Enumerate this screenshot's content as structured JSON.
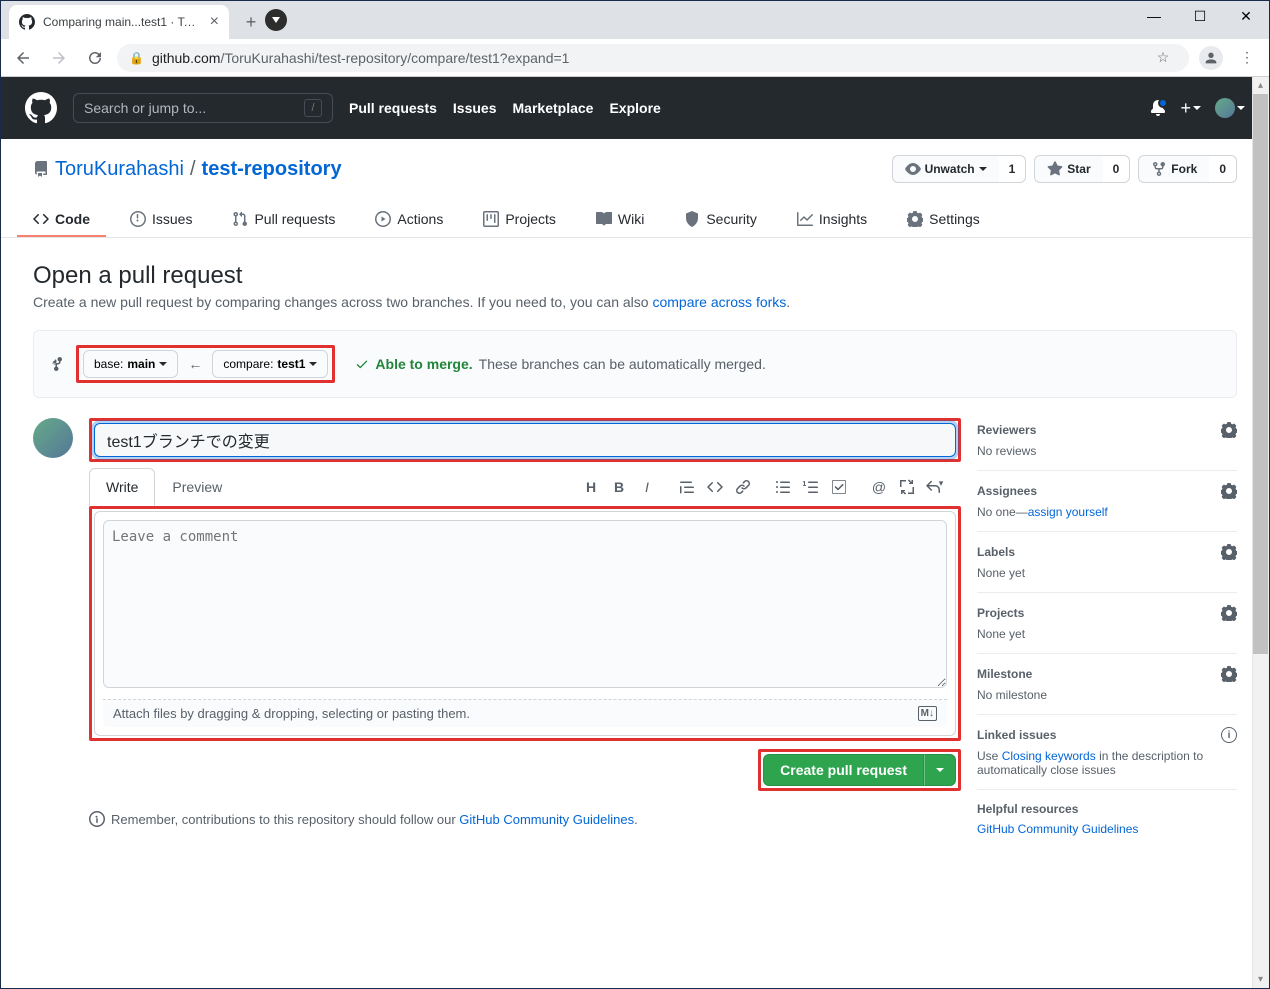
{
  "browser": {
    "tab_title": "Comparing main...test1 · ToruKur...",
    "url_domain": "github.com",
    "url_path": "/ToruKurahashi/test-repository/compare/test1?expand=1"
  },
  "header": {
    "search_placeholder": "Search or jump to...",
    "nav": [
      "Pull requests",
      "Issues",
      "Marketplace",
      "Explore"
    ]
  },
  "repo": {
    "owner": "ToruKurahashi",
    "name": "test-repository",
    "actions": {
      "unwatch": "Unwatch",
      "unwatch_count": "1",
      "star": "Star",
      "star_count": "0",
      "fork": "Fork",
      "fork_count": "0"
    },
    "tabs": [
      "Code",
      "Issues",
      "Pull requests",
      "Actions",
      "Projects",
      "Wiki",
      "Security",
      "Insights",
      "Settings"
    ]
  },
  "page": {
    "title": "Open a pull request",
    "subtitle_pre": "Create a new pull request by comparing changes across two branches. If you need to, you can also ",
    "subtitle_link": "compare across forks"
  },
  "compare": {
    "base_label": "base: ",
    "base_branch": "main",
    "compare_label": "compare: ",
    "compare_branch": "test1",
    "able": "Able to merge.",
    "desc": "These branches can be automatically merged."
  },
  "form": {
    "title_value": "test1ブランチでの変更",
    "write_tab": "Write",
    "preview_tab": "Preview",
    "comment_placeholder": "Leave a comment",
    "attach": "Attach files by dragging & dropping, selecting or pasting them.",
    "submit": "Create pull request"
  },
  "remember": {
    "text": "Remember, contributions to this repository should follow our ",
    "link": "GitHub Community Guidelines"
  },
  "sidebar": {
    "reviewers": {
      "title": "Reviewers",
      "body": "No reviews"
    },
    "assignees": {
      "title": "Assignees",
      "body_pre": "No one—",
      "body_link": "assign yourself"
    },
    "labels": {
      "title": "Labels",
      "body": "None yet"
    },
    "projects": {
      "title": "Projects",
      "body": "None yet"
    },
    "milestone": {
      "title": "Milestone",
      "body": "No milestone"
    },
    "linked": {
      "title": "Linked issues",
      "body_pre": "Use ",
      "body_link": "Closing keywords",
      "body_post": " in the description to automatically close issues"
    },
    "helpful": {
      "title": "Helpful resources",
      "link": "GitHub Community Guidelines"
    }
  }
}
